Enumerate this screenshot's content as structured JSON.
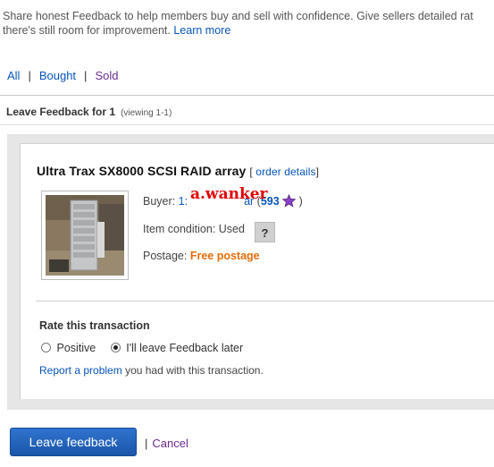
{
  "intro": {
    "line1": "Share honest Feedback to help members buy and sell with confidence. Give sellers detailed rat",
    "line2": "there's still room for improvement.",
    "learn_more": "Learn more"
  },
  "filters": {
    "all": "All",
    "bought": "Bought",
    "sold": "Sold",
    "sep": "|"
  },
  "header": {
    "title": "Leave Feedback for 1",
    "viewing": "(viewing 1-1)"
  },
  "item": {
    "title": "Ultra Trax SX8000 SCSI RAID array",
    "order_open": "[",
    "order_details": "order details",
    "order_close": "]",
    "buyer_label": "Buyer:",
    "buyer_id_start": "1:",
    "buyer_id_end": "ar",
    "buyer_paren_open": "(",
    "buyer_score": "593",
    "buyer_paren_close": ")",
    "overlay_text": "a.wanker",
    "condition_label": "Item condition:",
    "condition_value": "Used",
    "help_label": "?",
    "postage_label": "Postage:",
    "postage_value": "Free postage",
    "star_color": "#8a3fc9"
  },
  "rating": {
    "title": "Rate this transaction",
    "positive": "Positive",
    "later": "I'll leave Feedback later",
    "selected": "later",
    "report_link": "Report a problem",
    "report_rest": "you had with this transaction."
  },
  "actions": {
    "submit": "Leave feedback",
    "sep": "|",
    "cancel": "Cancel"
  },
  "colors": {
    "link": "#0654ba",
    "visited": "#6b2c91",
    "free_postage": "#e46d0a",
    "overlay": "#e00000",
    "button": "#1b56a8"
  }
}
